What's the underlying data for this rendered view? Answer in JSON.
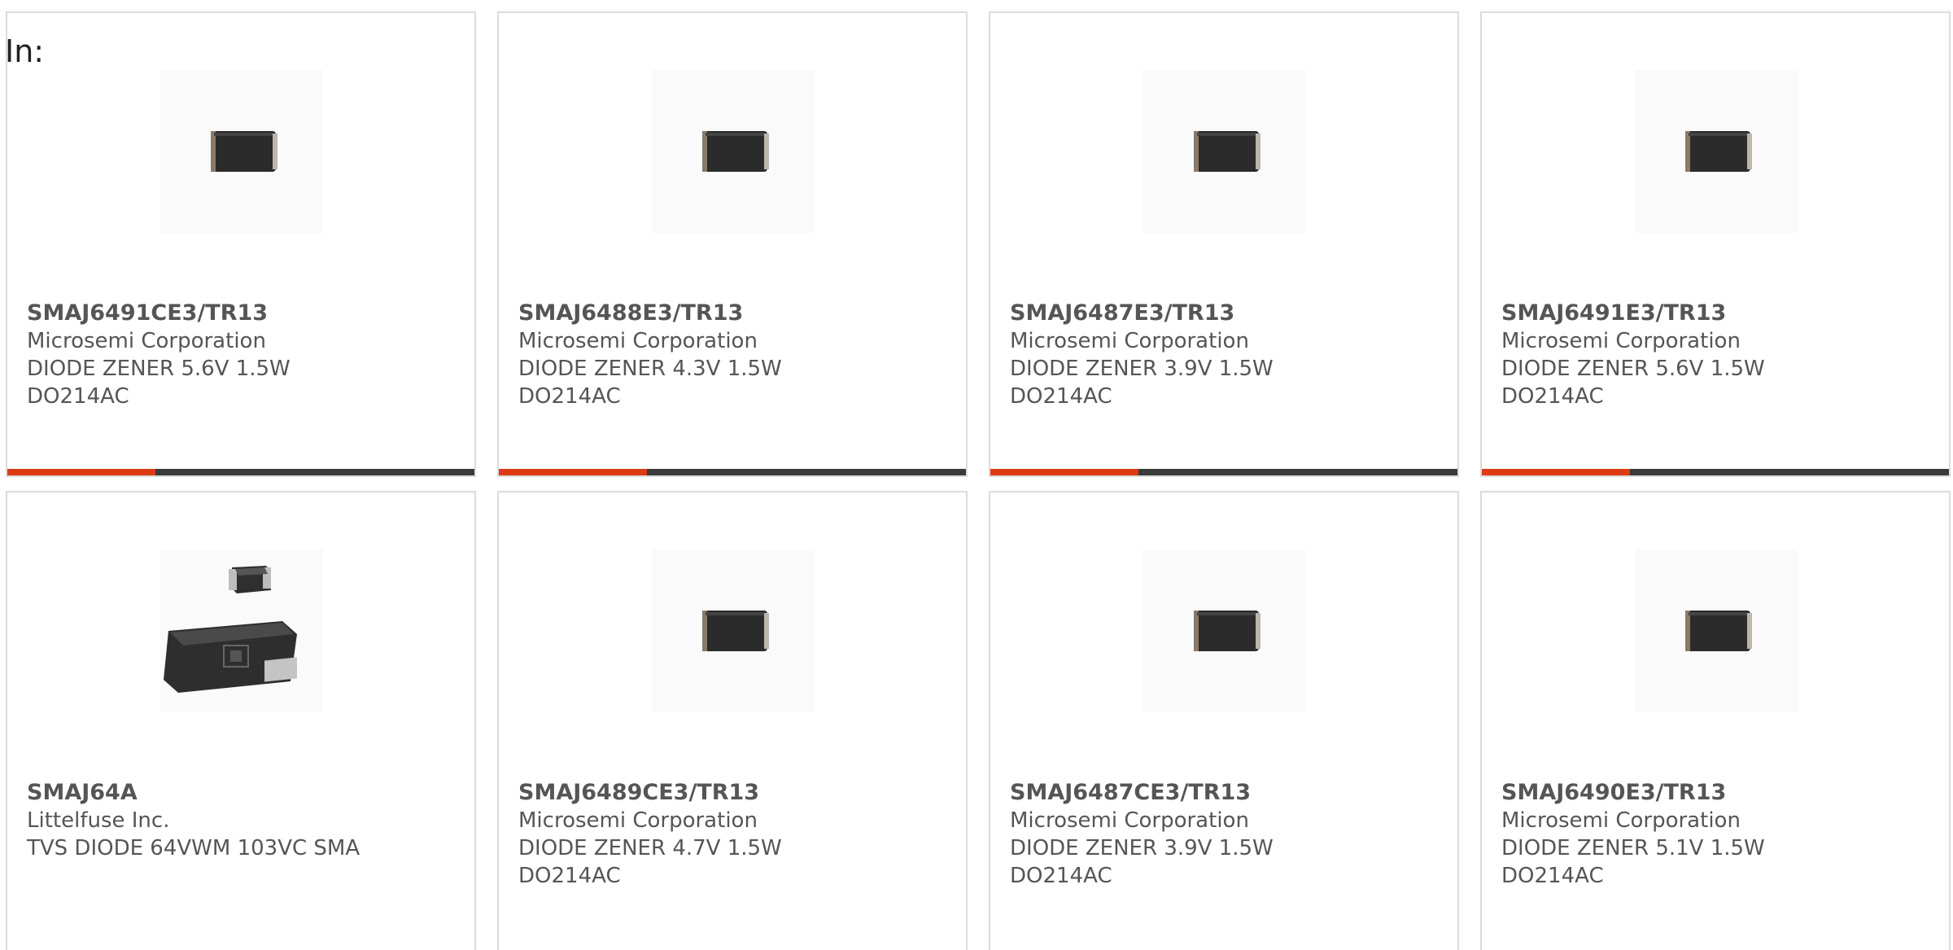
{
  "filter_label": "In:",
  "products": [
    {
      "part": "SMAJ6491CE3/TR13",
      "maker": "Microsemi Corporation",
      "desc1": "DIODE ZENER 5.6V 1.5W",
      "desc2": "DO214AC",
      "image": "smd-diode-icon"
    },
    {
      "part": "SMAJ6488E3/TR13",
      "maker": "Microsemi Corporation",
      "desc1": "DIODE ZENER 4.3V 1.5W",
      "desc2": "DO214AC",
      "image": "smd-diode-icon"
    },
    {
      "part": "SMAJ6487E3/TR13",
      "maker": "Microsemi Corporation",
      "desc1": "DIODE ZENER 3.9V 1.5W",
      "desc2": "DO214AC",
      "image": "smd-diode-icon"
    },
    {
      "part": "SMAJ6491E3/TR13",
      "maker": "Microsemi Corporation",
      "desc1": "DIODE ZENER 5.6V 1.5W",
      "desc2": "DO214AC",
      "image": "smd-diode-icon"
    },
    {
      "part": "SMAJ64A",
      "maker": "Littelfuse Inc.",
      "desc1": "TVS DIODE 64VWM 103VC SMA",
      "desc2": "",
      "image": "tvs-diode-package-icon"
    },
    {
      "part": "SMAJ6489CE3/TR13",
      "maker": "Microsemi Corporation",
      "desc1": "DIODE ZENER 4.7V 1.5W",
      "desc2": "DO214AC",
      "image": "smd-diode-icon"
    },
    {
      "part": "SMAJ6487CE3/TR13",
      "maker": "Microsemi Corporation",
      "desc1": "DIODE ZENER 3.9V 1.5W",
      "desc2": "DO214AC",
      "image": "smd-diode-icon"
    },
    {
      "part": "SMAJ6490E3/TR13",
      "maker": "Microsemi Corporation",
      "desc1": "DIODE ZENER 5.1V 1.5W",
      "desc2": "DO214AC",
      "image": "smd-diode-icon"
    }
  ],
  "colors": {
    "accent": "#dd3b12",
    "bar": "#3a3a3a",
    "text": "#555555",
    "border": "#dcdcdc"
  }
}
